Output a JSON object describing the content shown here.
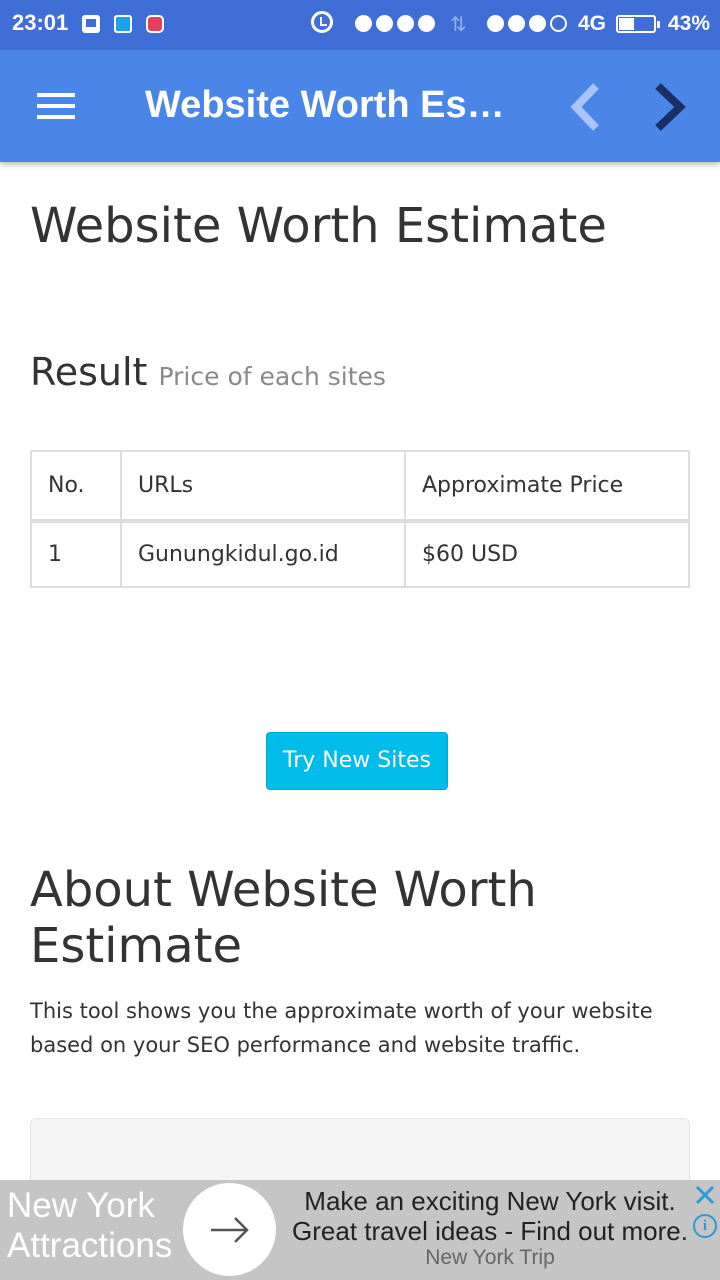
{
  "status_bar": {
    "time": "23:01",
    "network": "4G",
    "battery": "43%",
    "battery_level": 0.43,
    "icons": [
      "bbm-icon",
      "mi-icon",
      "instagram-icon",
      "alarm-icon",
      "signal-icon",
      "data-transfer-icon",
      "battery-icon"
    ]
  },
  "app_bar": {
    "title": "Website Worth Estimate",
    "icons": [
      "menu-icon",
      "chevron-left-icon",
      "chevron-right-icon"
    ],
    "colors": {
      "background": "#4a86e8",
      "status_bar": "#3f6fd6",
      "back_disabled": "#a9c4f5",
      "forward": "#1a2f66"
    }
  },
  "page": {
    "title": "Website Worth Estimate",
    "result": {
      "title": "Result",
      "subtitle": "Price of each sites"
    },
    "table": {
      "headers": [
        "No.",
        "URLs",
        "Approximate Price"
      ],
      "rows": [
        [
          "1",
          "Gunungkidul.go.id",
          "$60 USD"
        ]
      ]
    },
    "button_label": "Try New Sites",
    "about": {
      "title": "About Website Worth Estimate",
      "text": "This tool shows you the approximate worth of your website based on your SEO performance and website traffic."
    },
    "colors": {
      "button": "#00bcea",
      "text": "#333333",
      "muted": "#8a8a8a"
    }
  },
  "ad": {
    "brand_line1": "New York",
    "brand_line2": "Attractions",
    "headline1": "Make an exciting New York visit.",
    "headline2": "Great travel ideas - Find out more.",
    "source": "New York Trip",
    "icons": [
      "arrow-right-icon",
      "close-icon",
      "info-icon"
    ],
    "colors": {
      "background": "#c5c5c5",
      "controls": "#2a9bd8"
    }
  }
}
